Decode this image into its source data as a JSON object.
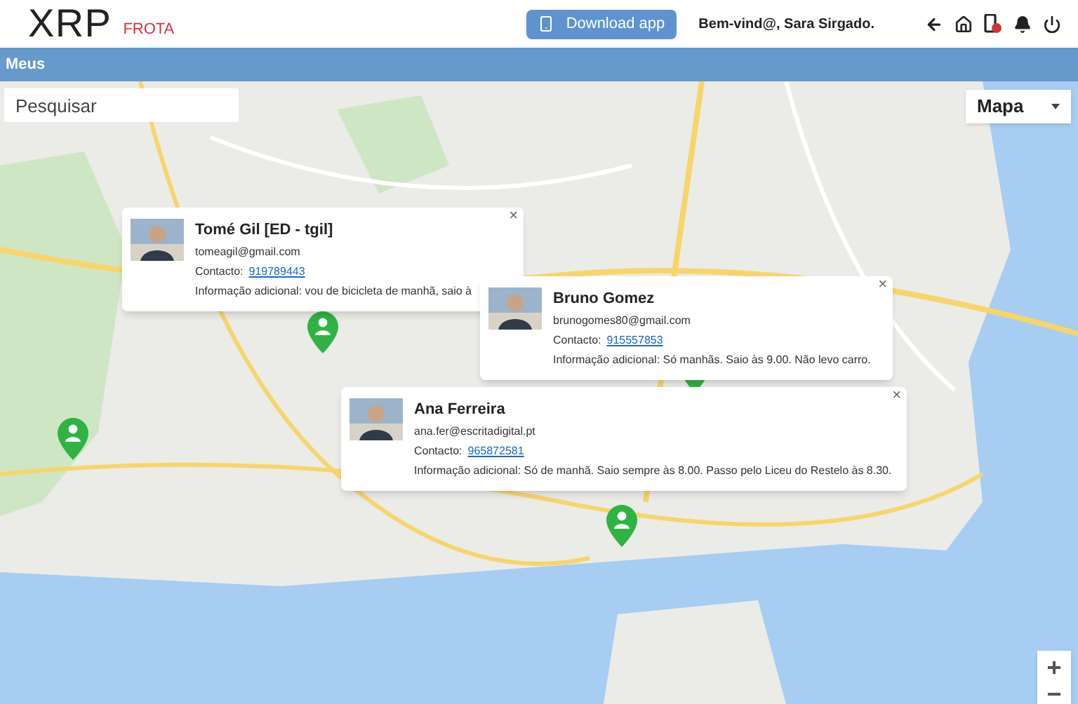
{
  "header": {
    "logo": "XRP",
    "logo_sub": "FROTA",
    "download_button": "Download app",
    "welcome": "Bem-vind@, Sara Sirgado."
  },
  "nav_bar": {
    "title": "Meus"
  },
  "map": {
    "search": {
      "placeholder": "Pesquisar"
    },
    "map_type": {
      "value": "Mapa"
    },
    "zoom_in": "+",
    "zoom_out": "−",
    "popups": [
      {
        "name": "Tomé Gil [ED - tgil]",
        "email": "tomeagil@gmail.com",
        "contact_label": "Contacto:",
        "phone": "919789443",
        "info": "Informação adicional: vou de bicicleta de manhã, saio à",
        "close": "×"
      },
      {
        "name": "Bruno Gomez",
        "email": "brunogomes80@gmail.com",
        "contact_label": "Contacto:",
        "phone": "915557853",
        "info": "Informação adicional: Só manhãs. Saio às 9.00. Não levo carro.",
        "close": "×"
      },
      {
        "name": "Ana Ferreira",
        "email": "ana.fer@escritadigital.pt",
        "contact_label": "Contacto:",
        "phone": "965872581",
        "info": "Informação adicional: Só de manhã. Saio sempre às 8.00. Passo pelo Liceu do Restelo às 8.30.",
        "close": "×"
      }
    ]
  }
}
